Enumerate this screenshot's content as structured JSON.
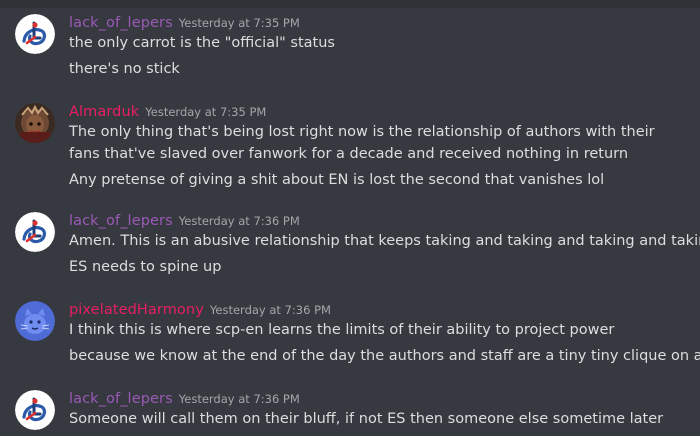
{
  "colors": {
    "background": "#36393f",
    "text": "#dcddde",
    "timestamp": "#a3a6aa",
    "user_lack": "#9b59b6",
    "user_almarduk": "#e91e63",
    "user_pixelated": "#e91e63"
  },
  "messages": [
    {
      "username": "lack_of_lepers",
      "timestamp": "Yesterday at 7:35 PM",
      "lines": [
        "the only carrot is the \"official\" status",
        "there's no stick"
      ]
    },
    {
      "username": "Almarduk",
      "timestamp": "Yesterday at 7:35 PM",
      "lines": [
        "The only thing that's being lost right now is the relationship of authors with their fans that've slaved over fanwork for a decade and received nothing in return",
        "Any pretense of giving a shit about EN is lost the second that vanishes lol"
      ]
    },
    {
      "username": "lack_of_lepers",
      "timestamp": "Yesterday at 7:36 PM",
      "lines": [
        "Amen. This is an abusive relationship that keeps taking and taking and taking and taking.",
        "ES needs to spine up"
      ]
    },
    {
      "username": "pixelatedHarmony",
      "timestamp": "Yesterday at 7:36 PM",
      "lines": [
        "I think this is where scp-en learns the limits of their ability to project power",
        "because we know at the end of the day the authors and staff are a tiny tiny clique on an island"
      ]
    },
    {
      "username": "lack_of_lepers",
      "timestamp": "Yesterday at 7:36 PM",
      "lines": [
        "Someone will call them on their bluff, if not ES then someone else sometime later"
      ]
    }
  ]
}
